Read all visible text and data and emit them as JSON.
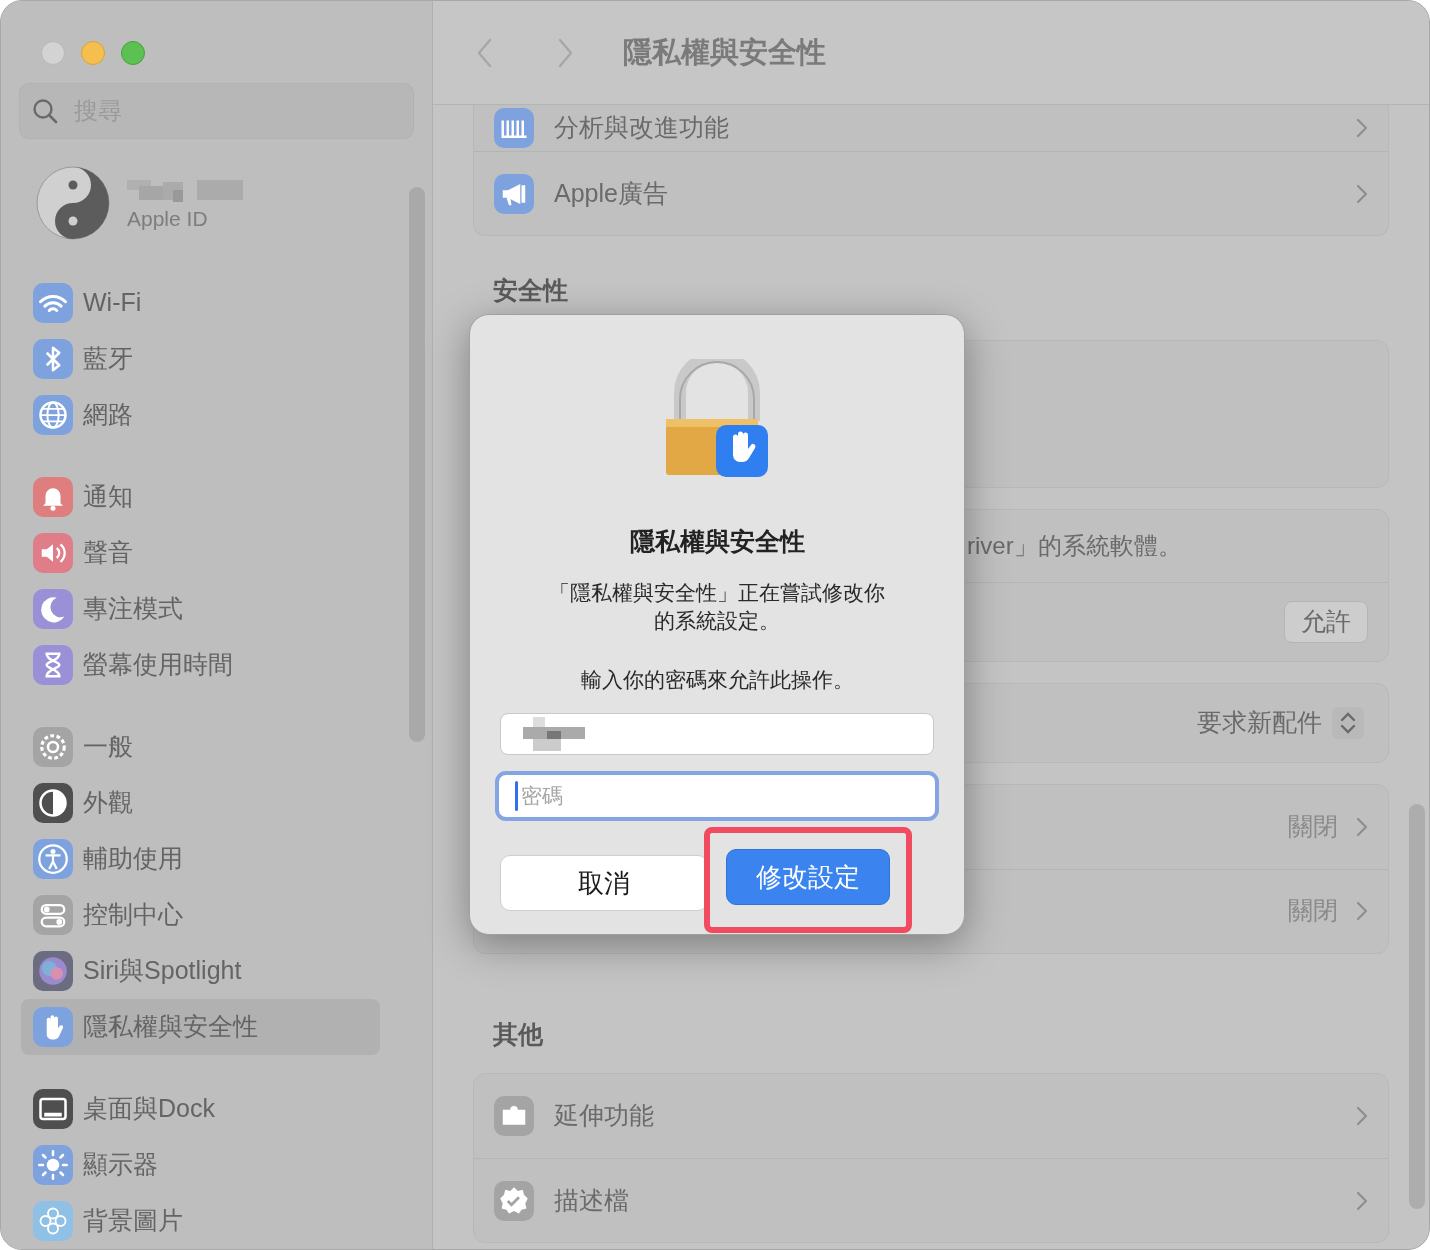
{
  "window": {
    "title": "隱私權與安全性",
    "back_enabled": false,
    "forward_enabled": false
  },
  "sidebar": {
    "search": {
      "placeholder": "搜尋"
    },
    "account": {
      "subtitle": "Apple ID"
    },
    "groups": [
      [
        {
          "label": "Wi-Fi",
          "selected": false
        },
        {
          "label": "藍牙",
          "selected": false
        },
        {
          "label": "網路",
          "selected": false
        }
      ],
      [
        {
          "label": "通知",
          "selected": false
        },
        {
          "label": "聲音",
          "selected": false
        },
        {
          "label": "專注模式",
          "selected": false
        },
        {
          "label": "螢幕使用時間",
          "selected": false
        }
      ],
      [
        {
          "label": "一般",
          "selected": false
        },
        {
          "label": "外觀",
          "selected": false
        },
        {
          "label": "輔助使用",
          "selected": false
        },
        {
          "label": "控制中心",
          "selected": false
        },
        {
          "label": "Siri與Spotlight",
          "selected": false
        },
        {
          "label": "隱私權與安全性",
          "selected": true
        }
      ],
      [
        {
          "label": "桌面與Dock",
          "selected": false
        },
        {
          "label": "顯示器",
          "selected": false
        },
        {
          "label": "背景圖片",
          "selected": false
        }
      ]
    ]
  },
  "sections": [
    {
      "cards": [
        {
          "kind": "list",
          "rows": [
            {
              "kind": "link",
              "label": "分析與改進功能"
            },
            {
              "kind": "link",
              "label": "Apple廣告"
            }
          ]
        }
      ]
    },
    {
      "heading": "安全性",
      "cards": [
        {
          "kind": "blank"
        },
        {
          "kind": "list",
          "rows": [
            {
              "kind": "text",
              "label": "river」的系統軟體。"
            },
            {
              "kind": "button",
              "value": "允許"
            }
          ]
        },
        {
          "kind": "list",
          "rows": [
            {
              "kind": "popup",
              "value": "要求新配件"
            }
          ]
        },
        {
          "kind": "list",
          "rows": [
            {
              "kind": "value-link",
              "value": "關閉"
            },
            {
              "kind": "value-link",
              "value": "關閉"
            }
          ]
        }
      ]
    },
    {
      "heading": "其他",
      "cards": [
        {
          "kind": "list",
          "rows": [
            {
              "kind": "link",
              "label": "延伸功能"
            },
            {
              "kind": "link",
              "label": "描述檔"
            }
          ]
        }
      ]
    }
  ],
  "dialog": {
    "title": "隱私權與安全性",
    "message": "「隱私權與安全性」正在嘗試修改你的系統設定。",
    "prompt": "輸入你的密碼來允許此操作。",
    "password_field": {
      "placeholder": "密碼",
      "focused": true
    },
    "buttons": [
      {
        "label": "取消",
        "kind": "secondary",
        "highlighted": false
      },
      {
        "label": "修改設定",
        "kind": "primary",
        "highlighted": true
      }
    ]
  }
}
